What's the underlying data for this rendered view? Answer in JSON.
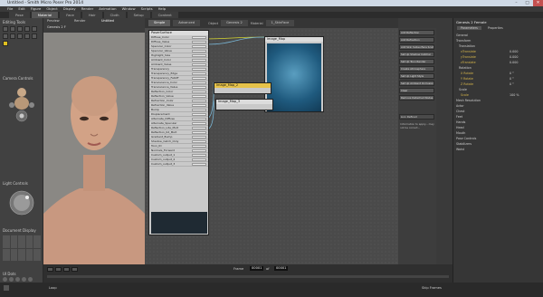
{
  "app": {
    "title": "Untitled - Smith Micro Poser Pro 2014"
  },
  "window": {
    "minimize": "–",
    "maximize": "□",
    "close": "✕"
  },
  "menu": [
    "File",
    "Edit",
    "Figure",
    "Object",
    "Display",
    "Render",
    "Animation",
    "Window",
    "Scripts",
    "Help"
  ],
  "room_tabs": [
    "Pose",
    "Material",
    "Face",
    "Hair",
    "Cloth",
    "Setup",
    "Content"
  ],
  "left": {
    "editing_tools": "Editing Tools",
    "camera_controls": "Camera Controls",
    "light_controls": "Light Controls",
    "document_display": "Document Display",
    "ui_dots": "UI Dots"
  },
  "viewport": {
    "tabs": [
      "Preview",
      "Render",
      "Untitled"
    ],
    "figure": "Genesis 2 F",
    "camera": "Main Camera"
  },
  "material": {
    "tabs": [
      "Simple",
      "Advanced"
    ],
    "object_label": "Object",
    "object": "Genesis 2",
    "material_label": "Material",
    "material": "1_SkinFace"
  },
  "poser_surface": {
    "title": "PoserSurface",
    "rows": [
      "Diffuse_Color",
      "Diffuse_Value",
      "Specular_Color",
      "Specular_Value",
      "Highlight_Size",
      "Ambient_Color",
      "Ambient_Value",
      "Transparency",
      "Transparency_Edge",
      "Transparency_Falloff",
      "Translucence_Color",
      "Translucence_Value",
      "Reflection_Color",
      "Reflection_Value",
      "Refraction_Color",
      "Refraction_Value",
      "Bump",
      "Displacement",
      "Alternate_Diffuse",
      "Alternate_Specular",
      "Reflection_Lite_Mult",
      "Reflection_Kd_Mult",
      "Gradient_Bump",
      "Shadow_Catch_Only",
      "Toon_ID",
      "Normals_Forward",
      "Custom_output_1",
      "Custom_output_2",
      "Custom_output_3"
    ]
  },
  "nodes": {
    "image_map": "Image_Map",
    "image_map_2": "Image_Map_2",
    "image_map_3": "Image_Map_3"
  },
  "right_buttons": [
    "Add Reflection",
    "Add Refraction",
    "Add Skin Subsurface Scattering",
    "Set Up Shadow Catcher",
    "Set Up Toon Render",
    "Create Atmosphere",
    "Set Up Light Style",
    "Set Up Ambient Occlusion",
    "Clear",
    "Remove Detached Nodes"
  ],
  "right_panel": {
    "wacros": "Lion Defined",
    "note": "Information to apply... may not be correct..."
  },
  "params": {
    "title": "Genesis 2 Female",
    "tabs": [
      "Parameters",
      "Properties"
    ],
    "rows": [
      "General",
      "Transform",
      "Translation",
      "xTranslate",
      "yTranslate",
      "zTranslate",
      "Rotation",
      "X Rotate",
      "Y Rotate",
      "Z Rotate",
      "Scale",
      "Scale",
      "Mesh Resolution",
      "Actor",
      "Chest",
      "Feet",
      "Hands",
      "Head",
      "Mouth",
      "Pose Controls",
      "Stabilizers",
      "Waist"
    ],
    "values": [
      "0.000",
      "0.000",
      "0.000",
      "0 °",
      "0 °",
      "0 °",
      "100 %"
    ]
  },
  "timeline": {
    "frame_label": "Frame",
    "frame": "00001",
    "of": "of",
    "total": "00001",
    "loop": "Loop",
    "skip": "Skip Frames"
  }
}
